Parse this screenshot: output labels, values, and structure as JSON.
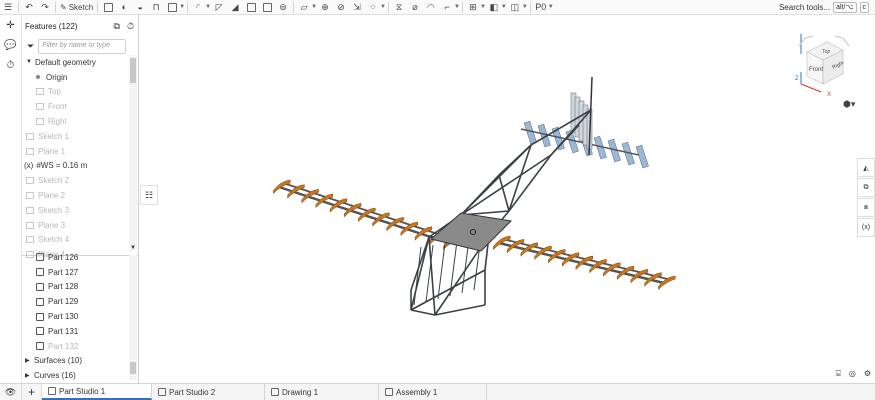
{
  "toolbar": {
    "sketch_label": "Sketch",
    "search_label": "Search tools...",
    "shortcut_label": "alt/⌥",
    "shortcut_key": "c",
    "paste_label": "P0"
  },
  "features": {
    "title": "Features (122)",
    "filter_placeholder": "Filter by name or type",
    "items": [
      {
        "label": "Default geometry",
        "kind": "group"
      },
      {
        "label": "Origin",
        "kind": "origin"
      },
      {
        "label": "Top",
        "kind": "plane"
      },
      {
        "label": "Front",
        "kind": "plane"
      },
      {
        "label": "Right",
        "kind": "plane"
      },
      {
        "label": "Sketch 1",
        "kind": "feature"
      },
      {
        "label": "Plane 1",
        "kind": "feature"
      },
      {
        "label": "#WS = 0.16 m",
        "kind": "variable"
      },
      {
        "label": "Sketch 2",
        "kind": "feature"
      },
      {
        "label": "Plane 2",
        "kind": "feature"
      },
      {
        "label": "Sketch 3",
        "kind": "feature"
      },
      {
        "label": "Plane 3",
        "kind": "feature"
      },
      {
        "label": "Sketch 4",
        "kind": "feature"
      },
      {
        "label": "Plane 4",
        "kind": "feature"
      }
    ]
  },
  "parts": {
    "items": [
      "Part 126",
      "Part 127",
      "Part 128",
      "Part 129",
      "Part 130",
      "Part 131",
      "Part 132"
    ],
    "surfaces": "Surfaces (10)",
    "curves": "Curves (16)"
  },
  "viewcube": {
    "top": "Top",
    "front": "Front",
    "right": "Right",
    "axis_z": "Z",
    "axis_x": "X"
  },
  "right_tools": [
    "appearance-icon",
    "parts-icon",
    "mates-icon",
    "variables-icon"
  ],
  "variables_label": "(x)",
  "tabs": [
    {
      "label": "Part Studio 1",
      "active": true
    },
    {
      "label": "Part Studio 2",
      "active": false
    },
    {
      "label": "Drawing 1",
      "active": false
    },
    {
      "label": "Assembly 1",
      "active": false
    }
  ],
  "colors": {
    "accent": "#2a73c8",
    "wing": "#c8771f",
    "frame": "#3a4048",
    "tail": "#9cb7d3"
  }
}
